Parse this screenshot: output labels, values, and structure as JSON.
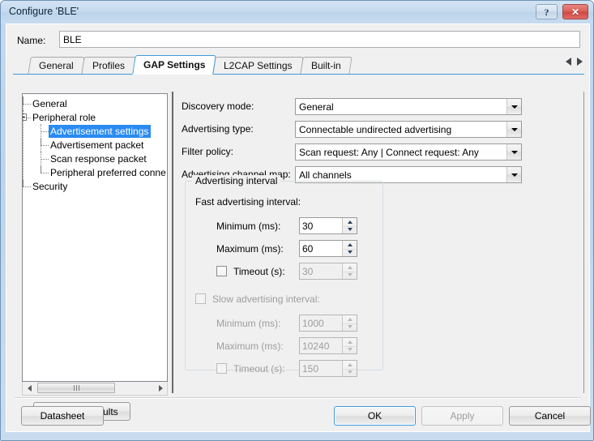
{
  "window": {
    "title": "Configure 'BLE'",
    "help_button": "?",
    "close_button": "✕"
  },
  "name_field": {
    "label": "Name:",
    "value": "BLE",
    "placeholder": ""
  },
  "tabs": [
    {
      "label": "General",
      "active": false
    },
    {
      "label": "Profiles",
      "active": false
    },
    {
      "label": "GAP Settings",
      "active": true
    },
    {
      "label": "L2CAP Settings",
      "active": false
    },
    {
      "label": "Built-in",
      "active": false
    }
  ],
  "tree": {
    "items": [
      {
        "label": "General",
        "level": 1,
        "selected": false,
        "expander": "none"
      },
      {
        "label": "Peripheral role",
        "level": 1,
        "selected": false,
        "expander": "expanded"
      },
      {
        "label": "Advertisement settings",
        "level": 2,
        "selected": true,
        "expander": "none"
      },
      {
        "label": "Advertisement packet",
        "level": 2,
        "selected": false,
        "expander": "none"
      },
      {
        "label": "Scan response packet",
        "level": 2,
        "selected": false,
        "expander": "none"
      },
      {
        "label": "Peripheral preferred conne",
        "level": 2,
        "selected": false,
        "expander": "none"
      },
      {
        "label": "Security",
        "level": 1,
        "selected": false,
        "expander": "none"
      }
    ]
  },
  "tree_scrollbar": {
    "left_arrow": "scroll-left-arrow",
    "right_arrow": "scroll-right-arrow"
  },
  "restore_defaults_button": "Restore Defaults",
  "settings": {
    "combos": [
      {
        "label": "Discovery mode:",
        "value": "General"
      },
      {
        "label": "Advertising type:",
        "value": "Connectable undirected advertising"
      },
      {
        "label": "Filter policy:",
        "value": "Scan request: Any | Connect request: Any"
      },
      {
        "label": "Advertising channel map:",
        "value": "All channels"
      }
    ],
    "advertising_interval": {
      "group_title": "Advertising interval",
      "fast": {
        "heading": "Fast advertising interval:",
        "minimum_label": "Minimum (ms):",
        "minimum_value": "30",
        "maximum_label": "Maximum (ms):",
        "maximum_value": "60",
        "timeout_label": "Timeout (s):",
        "timeout_value": "30",
        "timeout_checked": false
      },
      "slow": {
        "heading": "Slow advertising interval:",
        "heading_checked": false,
        "minimum_label": "Minimum (ms):",
        "minimum_value": "1000",
        "maximum_label": "Maximum (ms):",
        "maximum_value": "10240",
        "timeout_label": "Timeout (s):",
        "timeout_value": "150",
        "timeout_checked": false
      }
    }
  },
  "footer": {
    "datasheet": "Datasheet",
    "ok": "OK",
    "apply": "Apply",
    "cancel": "Cancel"
  },
  "colors": {
    "accent_blue": "#3c9bdd",
    "selection_blue": "#2a8bf2",
    "close_red": "#cf4740",
    "dialog_bg": "#f0f0f0",
    "disabled_text": "#9d9d9d"
  }
}
